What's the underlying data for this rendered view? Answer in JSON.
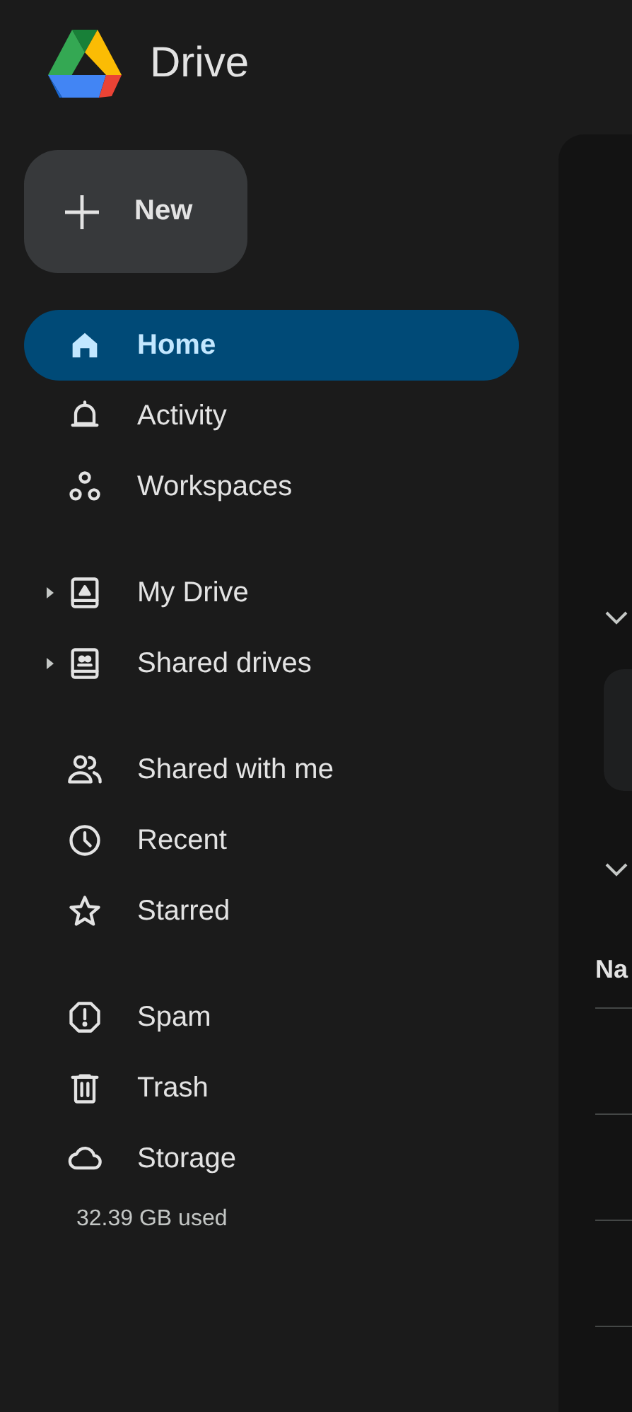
{
  "app": {
    "title": "Drive"
  },
  "new_button": {
    "label": "New"
  },
  "nav_groups": [
    {
      "items": [
        {
          "label": "Home",
          "selected": true,
          "expandable": false
        },
        {
          "label": "Activity",
          "selected": false,
          "expandable": false
        },
        {
          "label": "Workspaces",
          "selected": false,
          "expandable": false
        }
      ]
    },
    {
      "items": [
        {
          "label": "My Drive",
          "selected": false,
          "expandable": true
        },
        {
          "label": "Shared drives",
          "selected": false,
          "expandable": true
        }
      ]
    },
    {
      "items": [
        {
          "label": "Shared with me",
          "selected": false,
          "expandable": false
        },
        {
          "label": "Recent",
          "selected": false,
          "expandable": false
        },
        {
          "label": "Starred",
          "selected": false,
          "expandable": false
        }
      ]
    },
    {
      "items": [
        {
          "label": "Spam",
          "selected": false,
          "expandable": false
        },
        {
          "label": "Trash",
          "selected": false,
          "expandable": false
        },
        {
          "label": "Storage",
          "selected": false,
          "expandable": false
        }
      ]
    }
  ],
  "storage": {
    "usage": "32.39 GB used"
  },
  "main": {
    "column_heading": "Na"
  }
}
